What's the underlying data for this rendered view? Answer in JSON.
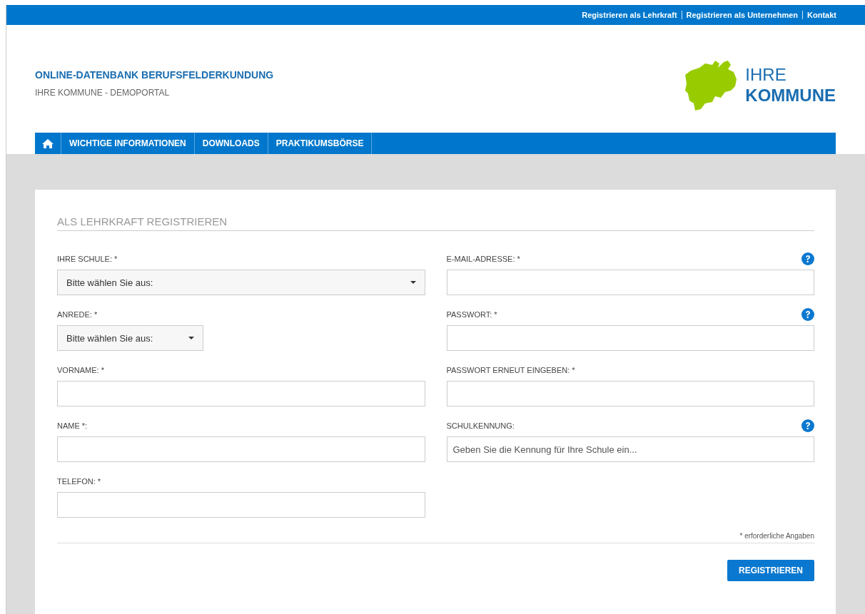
{
  "top_links": [
    "Registrieren als Lehrkraft",
    "Registrieren als Unternehmen",
    "Kontakt"
  ],
  "header": {
    "title": "ONLINE-DATENBANK BERUFSFELDERKUNDUNG",
    "subtitle": "IHRE KOMMUNE - DEMOPORTAL",
    "logo_lines": [
      "IHRE",
      "KOMMUNE"
    ]
  },
  "nav": [
    "WICHTIGE INFORMATIONEN",
    "DOWNLOADS",
    "PRAKTIKUMSBÖRSE"
  ],
  "form": {
    "title": "ALS LEHRKRAFT REGISTRIEREN",
    "left_fields": [
      {
        "label": "IHRE SCHULE: *",
        "kind": "select",
        "value": "Bitte wählen Sie aus:",
        "help": false
      },
      {
        "label": "ANREDE: *",
        "kind": "smallselect",
        "value": "Bitte wählen Sie aus:",
        "help": false
      },
      {
        "label": "VORNAME: *",
        "kind": "text",
        "help": false
      },
      {
        "label": "NAME *:",
        "kind": "text",
        "help": false
      },
      {
        "label": "TELEFON: *",
        "kind": "text",
        "help": false
      }
    ],
    "right_fields": [
      {
        "label": "E-MAIL-ADRESSE: *",
        "kind": "text",
        "help": true
      },
      {
        "label": "PASSWORT: *",
        "kind": "text",
        "help": true
      },
      {
        "label": "PASSWORT ERNEUT EINGEBEN: *",
        "kind": "text",
        "help": false
      },
      {
        "label": "SCHULKENNUNG:",
        "kind": "text",
        "placeholder": "Geben Sie die Kennung für Ihre Schule ein...",
        "help": true
      }
    ],
    "required_note": "* erforderliche Angaben",
    "submit": "REGISTRIEREN"
  }
}
